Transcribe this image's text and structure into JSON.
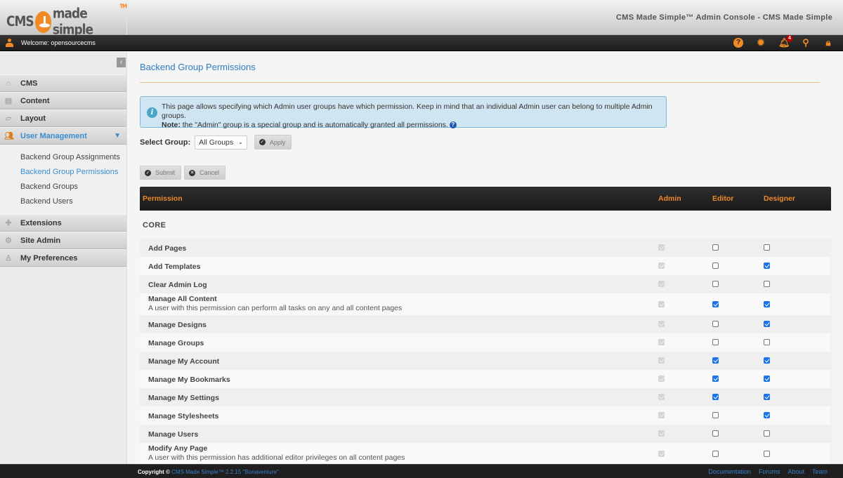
{
  "header": {
    "logo_left": "CMS",
    "logo_right": "made simple",
    "logo_tm": "TM",
    "site_title": "CMS Made Simple™ Admin Console - CMS Made Simple"
  },
  "topbar": {
    "welcome": "Welcome: opensourcecms",
    "notification_count": "4",
    "icons": [
      "help-icon",
      "settings-icon",
      "notifications-icon",
      "search-icon",
      "lock-icon"
    ]
  },
  "sidebar": {
    "items": [
      {
        "label": "CMS",
        "icon": "home-icon"
      },
      {
        "label": "Content",
        "icon": "content-icon"
      },
      {
        "label": "Layout",
        "icon": "layout-icon"
      },
      {
        "label": "User Management",
        "icon": "users-icon",
        "active": true
      },
      {
        "label": "Extensions",
        "icon": "puzzle-icon"
      },
      {
        "label": "Site Admin",
        "icon": "gear-icon"
      },
      {
        "label": "My Preferences",
        "icon": "user-icon"
      }
    ],
    "subitems": [
      {
        "label": "Backend Group Assignments"
      },
      {
        "label": "Backend Group Permissions",
        "current": true
      },
      {
        "label": "Backend Groups"
      },
      {
        "label": "Backend Users"
      }
    ]
  },
  "main": {
    "title": "Backend Group Permissions",
    "info_text": "This page allows specifying which Admin user groups have which permission. Keep in mind that an individual Admin user can belong to multiple Admin groups.",
    "info_note_label": "Note:",
    "info_note_text": " the \"Admin\" group is a special group and is automatically granted all permissions.",
    "select_label": "Select Group:",
    "select_value": "All Groups",
    "apply_label": "Apply",
    "submit_label": "Submit",
    "cancel_label": "Cancel"
  },
  "table": {
    "headers": {
      "permission": "Permission",
      "admin": "Admin",
      "editor": "Editor",
      "designer": "Designer"
    },
    "section": "CORE",
    "rows": [
      {
        "name": "Add Pages",
        "desc": "",
        "admin": true,
        "editor": false,
        "designer": false
      },
      {
        "name": "Add Templates",
        "desc": "",
        "admin": true,
        "editor": false,
        "designer": true
      },
      {
        "name": "Clear Admin Log",
        "desc": "",
        "admin": true,
        "editor": false,
        "designer": false
      },
      {
        "name": "Manage All Content",
        "desc": "A user with this permission can perform all tasks on any and all content pages",
        "admin": true,
        "editor": true,
        "designer": true
      },
      {
        "name": "Manage Designs",
        "desc": "",
        "admin": true,
        "editor": false,
        "designer": true
      },
      {
        "name": "Manage Groups",
        "desc": "",
        "admin": true,
        "editor": false,
        "designer": false
      },
      {
        "name": "Manage My Account",
        "desc": "",
        "admin": true,
        "editor": true,
        "designer": true
      },
      {
        "name": "Manage My Bookmarks",
        "desc": "",
        "admin": true,
        "editor": true,
        "designer": true
      },
      {
        "name": "Manage My Settings",
        "desc": "",
        "admin": true,
        "editor": true,
        "designer": true
      },
      {
        "name": "Manage Stylesheets",
        "desc": "",
        "admin": true,
        "editor": false,
        "designer": true
      },
      {
        "name": "Manage Users",
        "desc": "",
        "admin": true,
        "editor": false,
        "designer": false
      },
      {
        "name": "Modify Any Page",
        "desc": "A user with this permission has additional editor privileges on all content pages",
        "admin": true,
        "editor": false,
        "designer": false
      }
    ]
  },
  "footer": {
    "copyright_label": "Copyright ©",
    "version_link": "CMS Made Simple™ 2.2.15 \"Bonaventure\"",
    "links": [
      "Documentation",
      "Forums",
      "About",
      "Team"
    ]
  }
}
